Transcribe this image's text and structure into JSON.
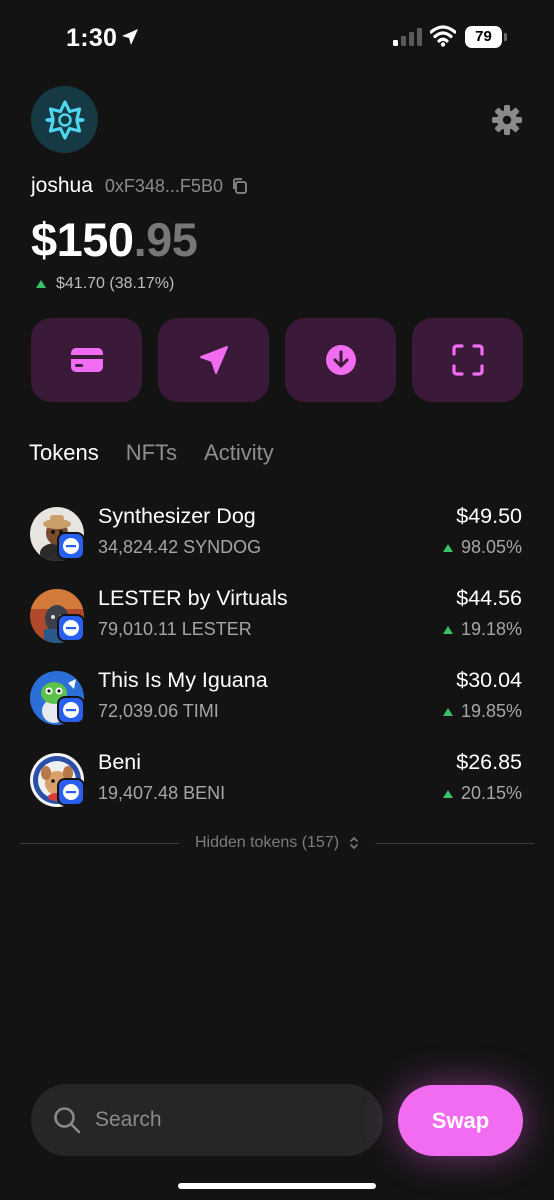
{
  "status_bar": {
    "time": "1:30",
    "battery": "79",
    "icons": [
      "location-arrow-icon",
      "signal-icon",
      "wifi-icon",
      "battery-icon"
    ]
  },
  "account": {
    "username": "joshua",
    "address": "0xF348...F5B0",
    "balance_whole": "$150",
    "balance_cents": ".95",
    "change": "$41.70 (38.17%)",
    "change_direction": "up"
  },
  "actions": [
    {
      "icon": "card-icon"
    },
    {
      "icon": "send-icon"
    },
    {
      "icon": "receive-icon"
    },
    {
      "icon": "scan-icon"
    }
  ],
  "tabs": [
    {
      "label": "Tokens",
      "active": true
    },
    {
      "label": "NFTs",
      "active": false
    },
    {
      "label": "Activity",
      "active": false
    }
  ],
  "tokens": [
    {
      "name": "Synthesizer Dog",
      "amount": "34,824.42 SYNDOG",
      "value": "$49.50",
      "change": "98.05%",
      "direction": "up"
    },
    {
      "name": "LESTER by Virtuals",
      "amount": "79,010.11 LESTER",
      "value": "$44.56",
      "change": "19.18%",
      "direction": "up"
    },
    {
      "name": "This Is My Iguana",
      "amount": "72,039.06 TIMI",
      "value": "$30.04",
      "change": "19.85%",
      "direction": "up"
    },
    {
      "name": "Beni",
      "amount": "19,407.48 BENI",
      "value": "$26.85",
      "change": "20.15%",
      "direction": "up"
    }
  ],
  "hidden_tokens": "Hidden tokens (157)",
  "search": {
    "placeholder": "Search"
  },
  "swap_label": "Swap",
  "colors": {
    "background": "#131313",
    "accent": "#f26cf2",
    "action_bg": "#3a1a38",
    "positive": "#37c26a",
    "chain_badge": "#2a60f0"
  }
}
